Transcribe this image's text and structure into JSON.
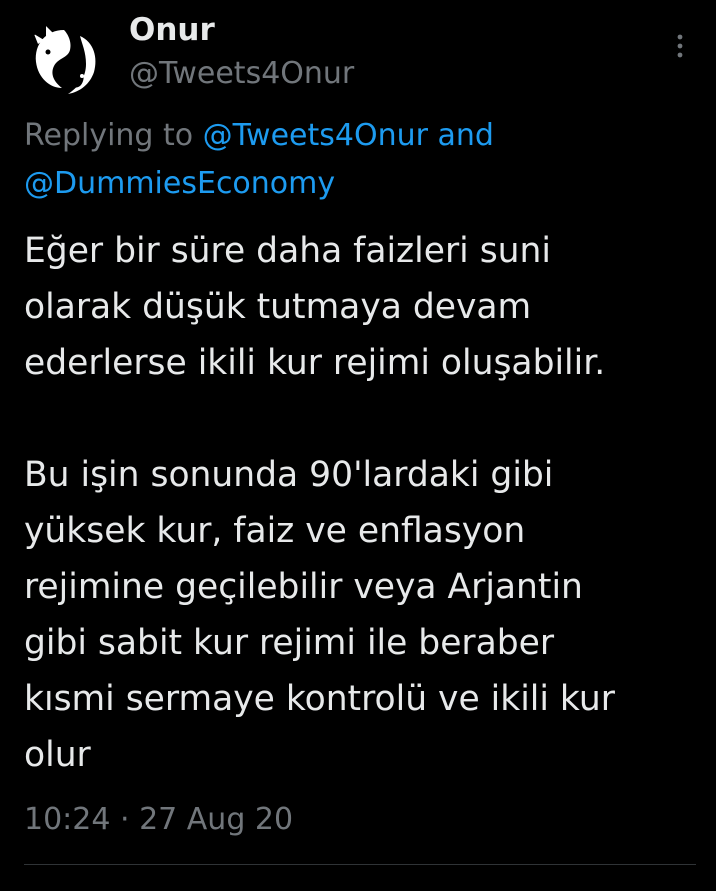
{
  "author": {
    "display_name": "Onur",
    "handle": "@Tweets4Onur",
    "avatar_icon": "yin-yang-cats-icon"
  },
  "menu": {
    "icon": "more-vertical-icon"
  },
  "reply_context": {
    "prefix": "Replying to ",
    "mention_1": "@Tweets4Onur",
    "conjunction": " and ",
    "mention_2": "@DummiesEconomy"
  },
  "tweet": {
    "paragraph_1": [
      "Eğer bir süre daha faizleri suni",
      "olarak düşük tutmaya devam",
      "ederlerse ikili kur rejimi oluşabilir."
    ],
    "paragraph_2": [
      "Bu işin sonunda 90'lardaki gibi",
      "yüksek kur, faiz ve enflasyon",
      "rejimine geçilebilir veya Arjantin",
      "gibi sabit kur rejimi ile beraber",
      "kısmi sermaye kontrolü ve ikili kur",
      "olur"
    ]
  },
  "meta": {
    "time": "10:24",
    "separator": " · ",
    "date": "27 Aug 20"
  },
  "colors": {
    "background": "#000000",
    "primary_text": "#e7e9ea",
    "secondary_text": "#71767b",
    "accent": "#1d9bf0",
    "divider": "#2f3336"
  }
}
